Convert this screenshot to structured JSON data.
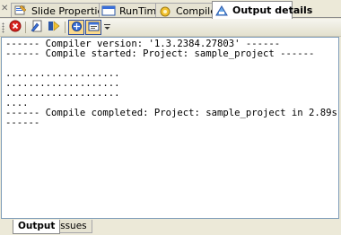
{
  "tabs": [
    {
      "label": "Slide Properties",
      "icon": "slide-properties-icon",
      "active": false
    },
    {
      "label": "RunTime",
      "icon": "runtime-icon",
      "active": false
    },
    {
      "label": "Compilers",
      "icon": "compilers-icon",
      "active": false
    },
    {
      "label": "Output details",
      "icon": "output-details-icon",
      "active": true
    }
  ],
  "toolbar": {
    "buttons": [
      {
        "icon": "stop-red-icon",
        "pressed": false
      },
      {
        "icon": "edit-clear-icon",
        "pressed": false
      },
      {
        "icon": "compile-icon",
        "pressed": false
      },
      {
        "icon": "word-wrap-icon",
        "pressed": true
      },
      {
        "icon": "output-window-icon",
        "pressed": true
      }
    ]
  },
  "output": {
    "lines": [
      "------ Compiler version: '1.3.2384.27803' ------",
      "------ Compile started: Project: sample_project ------",
      "",
      "....................",
      "....................",
      "....................",
      "....",
      "------ Compile completed: Project: sample_project in 2.89s",
      "------"
    ]
  },
  "bottom_tabs": [
    {
      "label": "Output",
      "active": true
    },
    {
      "label": "Issues",
      "active": false
    }
  ],
  "colors": {
    "accent": "#fbd98b",
    "chrome": "#ece9d8",
    "border": "#7f9db9"
  }
}
